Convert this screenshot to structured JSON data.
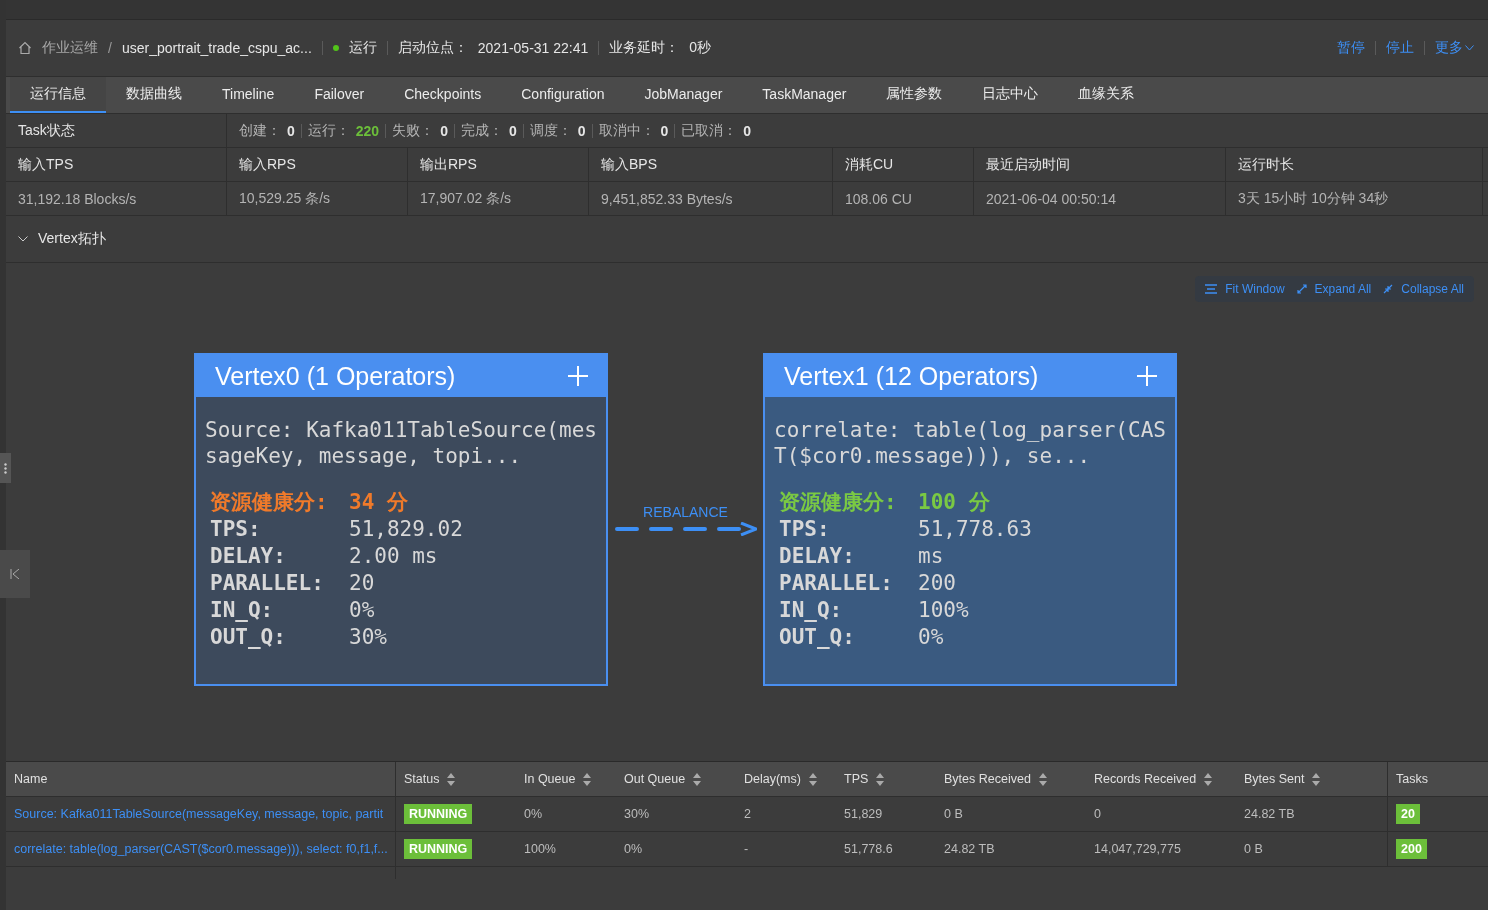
{
  "header": {
    "breadcrumb": [
      "作业运维",
      "user_portrait_trade_cspu_ac..."
    ],
    "separator": "/",
    "status": {
      "label": "运行",
      "color": "#52c41a"
    },
    "fields": [
      {
        "label": "启动位点：",
        "value": "2021-05-31 22:41"
      },
      {
        "label": "业务延时：",
        "value": "0秒"
      }
    ],
    "actions": [
      {
        "label": "暂停",
        "kind": "plain"
      },
      {
        "label": "停止",
        "kind": "plain"
      },
      {
        "label": "更多",
        "kind": "menu"
      }
    ]
  },
  "tabs": [
    {
      "label": "运行信息",
      "selected": true
    },
    {
      "label": "数据曲线",
      "selected": false
    },
    {
      "label": "Timeline",
      "selected": false
    },
    {
      "label": "Failover",
      "selected": false
    },
    {
      "label": "Checkpoints",
      "selected": false
    },
    {
      "label": "Configuration",
      "selected": false
    },
    {
      "label": "JobManager",
      "selected": false
    },
    {
      "label": "TaskManager",
      "selected": false
    },
    {
      "label": "属性参数",
      "selected": false
    },
    {
      "label": "日志中心",
      "selected": false
    },
    {
      "label": "血缘关系",
      "selected": false
    }
  ],
  "task_status": {
    "label": "Task状态",
    "counts": [
      {
        "label": "创建：",
        "value": "0",
        "color": "#e6e6e6"
      },
      {
        "label": "运行：",
        "value": "220",
        "color": "#6cbf3a"
      },
      {
        "label": "失败：",
        "value": "0",
        "color": "#e6e6e6"
      },
      {
        "label": "完成：",
        "value": "0",
        "color": "#e6e6e6"
      },
      {
        "label": "调度：",
        "value": "0",
        "color": "#e6e6e6"
      },
      {
        "label": "取消中：",
        "value": "0",
        "color": "#e6e6e6"
      },
      {
        "label": "已取消：",
        "value": "0",
        "color": "#e6e6e6"
      }
    ]
  },
  "metrics": [
    {
      "label": "输入TPS",
      "value": "31,192.18 Blocks/s"
    },
    {
      "label": "输入RPS",
      "value": "10,529.25 条/s"
    },
    {
      "label": "输出RPS",
      "value": "17,907.02 条/s"
    },
    {
      "label": "输入BPS",
      "value": "9,451,852.33 Bytes/s"
    },
    {
      "label": "消耗CU",
      "value": "108.06 CU"
    },
    {
      "label": "最近启动时间",
      "value": "2021-06-04 00:50:14"
    },
    {
      "label": "运行时长",
      "value": "3天 15小时 10分钟 34秒"
    }
  ],
  "topology": {
    "label": "Vertex拓扑",
    "expanded": true,
    "toolbar": [
      {
        "label": "Fit Window",
        "kind": "fit"
      },
      {
        "label": "Expand All",
        "kind": "expand"
      },
      {
        "label": "Collapse All",
        "kind": "collapse"
      }
    ],
    "vertices": [
      {
        "title": "Vertex0 (1 Operators)",
        "selected": false,
        "description": "Source: Kafka011TableSource(messageKey, message, topi...",
        "score_label": "资源健康分:",
        "score": "34 分",
        "color": "#f07a2a",
        "stats": [
          {
            "label": "TPS:",
            "value": "51,829.02"
          },
          {
            "label": "DELAY:",
            "value": "2.00 ms"
          },
          {
            "label": "PARALLEL:",
            "value": "20"
          },
          {
            "label": "IN_Q:",
            "value": "0%"
          },
          {
            "label": "OUT_Q:",
            "value": "30%"
          }
        ]
      },
      {
        "title": "Vertex1 (12 Operators)",
        "selected": true,
        "description": "correlate: table(log_parser(CAST($cor0.message))), se...",
        "score_label": "资源健康分:",
        "score": "100 分",
        "color": "#7ac943",
        "stats": [
          {
            "label": "TPS:",
            "value": "51,778.63"
          },
          {
            "label": "DELAY:",
            "value": "ms"
          },
          {
            "label": "PARALLEL:",
            "value": "200"
          },
          {
            "label": "IN_Q:",
            "value": "100%"
          },
          {
            "label": "OUT_Q:",
            "value": "0%"
          }
        ]
      }
    ],
    "edge": {
      "label": "REBALANCE"
    }
  },
  "table": {
    "columns": [
      {
        "label": "Name",
        "sortable": false
      },
      {
        "label": "Status",
        "sortable": true
      },
      {
        "label": "In Queue",
        "sortable": true
      },
      {
        "label": "Out Queue",
        "sortable": true
      },
      {
        "label": "Delay(ms)",
        "sortable": true
      },
      {
        "label": "TPS",
        "sortable": true
      },
      {
        "label": "Bytes Received",
        "sortable": true
      },
      {
        "label": "Records Received",
        "sortable": true
      },
      {
        "label": "Bytes Sent",
        "sortable": true
      },
      {
        "label": "Tasks",
        "sortable": false
      }
    ],
    "rows": [
      {
        "cells": [
          "Source: Kafka011TableSource(messageKey, message, topic, partit",
          "RUNNING",
          "0%",
          "30%",
          "2",
          "51,829",
          "0 B",
          "0",
          "24.82 TB",
          "20"
        ]
      },
      {
        "cells": [
          "correlate: table(log_parser(CAST($cor0.message))), select: f0,f1,f...",
          "RUNNING",
          "100%",
          "0%",
          "-",
          "51,778.6",
          "24.82 TB",
          "14,047,729,775",
          "0 B",
          "200"
        ]
      }
    ]
  }
}
